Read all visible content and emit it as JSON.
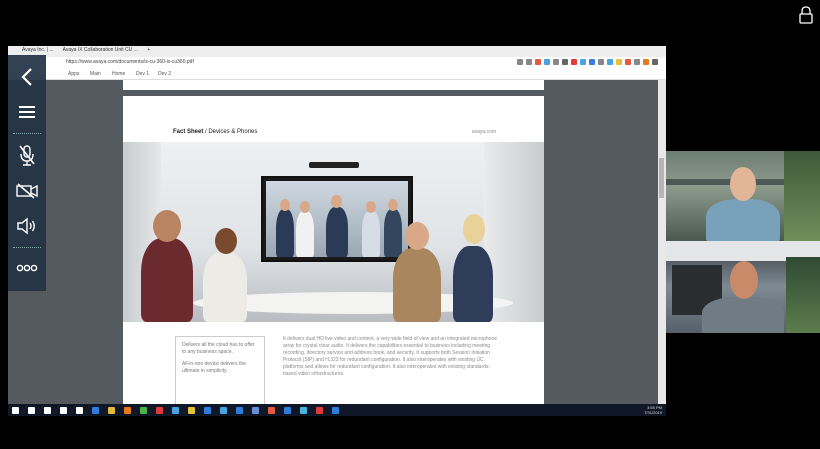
{
  "browser": {
    "tabs": [
      "Avaya Inc. | ...",
      "Avaya IX Collaboration Unit CU ...",
      "+"
    ],
    "url": "https://www.avaya.com/documents/ix-cu-360-ix-cu360.pdf",
    "bookmarks": [
      "Apps",
      "Main",
      "Home",
      "Dev 1",
      "Dev 2"
    ],
    "extension_colors": [
      "#888888",
      "#888888",
      "#e35b3b",
      "#4aa3df",
      "#888888",
      "#666666",
      "#e33b3b",
      "#4aa3df",
      "#3b7be3",
      "#888888",
      "#4aa3df",
      "#e3c13b",
      "#e35b3b",
      "#888888",
      "#e37b1b",
      "#666666"
    ]
  },
  "document": {
    "header_bold": "Fact Sheet",
    "header_rest": " / Devices & Phones",
    "header_url": "avaya.com",
    "bullets": [
      "Delivers all the cloud has to offer to any business space.",
      "All-in-one device delivers the ultimate in simplicity."
    ],
    "body": "It delivers dual HD live video and content, a very wide field of view and an integrated microphone array for crystal clear audio. It delivers the capabilities essential to business including meeting recording, directory service and address book, and security. It supports both Session Initiation Protocol (SIP) and H.323 for redundant configuration. It also interoperates with existing UC platforms and allows for redundant configuration. It also interoperates with existing standards-based video infrastructures."
  },
  "taskbar": {
    "time": "3:55 PM",
    "date": "7/31/2019",
    "icon_colors": [
      "#ffffff",
      "#ffffff",
      "#ffffff",
      "#ffffff",
      "#ffffff",
      "#2f7bd9",
      "#e3b83b",
      "#e37b1b",
      "#4ab34a",
      "#e33b3b",
      "#4aa3df",
      "#e3c13b",
      "#2f7bd9",
      "#4aa3df",
      "#2f7bd9",
      "#6a8fd9",
      "#e35b3b",
      "#2f7bd9",
      "#4ab3df",
      "#e33b3b",
      "#2f7bd9"
    ]
  },
  "panel": {
    "buttons": [
      "back-icon",
      "menu-icon",
      "mic-muted-icon",
      "camera-off-icon",
      "speaker-icon",
      "more-icon"
    ]
  },
  "participants": [
    "participant-1",
    "participant-2"
  ],
  "icons": {
    "lock": "lock-icon"
  },
  "colors": {
    "panel_bg": "#22344699",
    "accent": "#2f7bd9"
  }
}
